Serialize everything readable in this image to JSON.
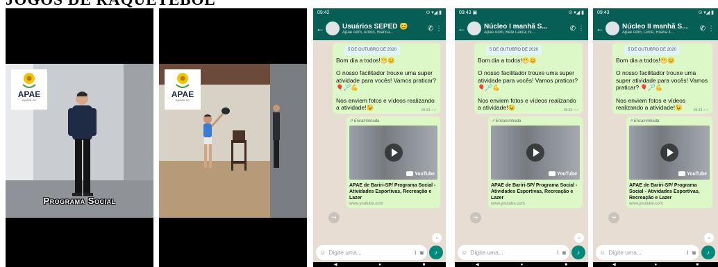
{
  "page_title": "JOGOS DE RAQUETEBOL",
  "videos": [
    {
      "logo_text": "APAE",
      "logo_sub": "BARIRI-SP",
      "caption": "Programa Social"
    },
    {
      "logo_text": "APAE",
      "logo_sub": "BARIRI-SP"
    }
  ],
  "phones": [
    {
      "status_time": "09:42",
      "status_icons": "⊙ ▾◢ ▮",
      "chat_name": "Usuários SEPED 😊",
      "members": "Apae Adm, Arnon, Bianca...",
      "date_chip": "5 DE OUTUBRO DE 2020",
      "message_greeting": "Bom dia a todos!😁😊",
      "message_body": "O nosso facilitador trouxe uma super atividade para vocês! Vamos praticar? 🎈🏸💪",
      "message_request": "Nos enviem fotos e vídeos realizando a atividade!😉",
      "message_time": "09:33 ✓✓",
      "forwarded_label": "↗ Encaminhada",
      "youtube_label": "YouTube",
      "link_title": "APAE de Bariri-SP/ Programa Social - Atividades Esportivas, Recreação e Lazer",
      "link_url": "www.youtube.com",
      "input_placeholder": "Digite uma..."
    },
    {
      "status_time": "09:43 ▣",
      "status_icons": "⊙ ▾◢ ▮",
      "chat_name": "Núcleo I manhã S...",
      "members": "Apae Adm, Bete Laura, Iv...",
      "date_chip": "5 DE OUTUBRO DE 2020",
      "message_greeting": "Bom dia a todos!😁😊",
      "message_body": "O nosso facilitador trouxe uma super atividade para vocês! Vamos praticar? 🎈🏸💪",
      "message_request": "Nos enviem fotos e vídeos realizando a atividade!😉",
      "message_time": "09:33 ✓✓",
      "forwarded_label": "↗ Encaminhada",
      "youtube_label": "YouTube",
      "link_title": "APAE de Bariri-SP/ Programa Social - Atividades Esportivas, Recreação e Lazer",
      "link_url": "www.youtube.com",
      "input_placeholder": "Digite uma..."
    },
    {
      "status_time": "09:43",
      "status_icons": "⊙ ▾◢ ▮",
      "chat_name": "Núcleo II manhã S...",
      "members": "Apae Adm, Dirce, Eliana ll...",
      "date_chip": "5 DE OUTUBRO DE 2020",
      "message_greeting": "Bom dia a todos!😁😊",
      "message_body": "O nosso facilitador trouxe uma super atividade para vocês! Vamos praticar? 🎈🏸💪",
      "message_request": "Nos enviem fotos e vídeos realizando a atividade!😉",
      "message_time": "09:33 ✓✓",
      "forwarded_label": "↗ Encaminhada",
      "youtube_label": "YouTube",
      "link_title": "APAE de Bariri-SP/ Programa Social - Atividades Esportivas, Recreação e Lazer",
      "link_url": "www.youtube.com",
      "input_placeholder": "Digite uma..."
    }
  ],
  "colors": {
    "whatsapp_header": "#075e54",
    "bubble_green": "#dcf8c6",
    "chat_bg": "#e7ddd3",
    "mic_green": "#00897b"
  },
  "icons": {
    "back": "arrow-left-icon",
    "call": "phone-plus-icon",
    "menu": "more-vert-icon",
    "emoji": "emoji-icon",
    "attach": "paperclip-icon",
    "camera": "camera-icon",
    "mic": "microphone-icon",
    "share": "share-icon",
    "scroll": "chevron-down-icon",
    "play": "play-icon"
  }
}
